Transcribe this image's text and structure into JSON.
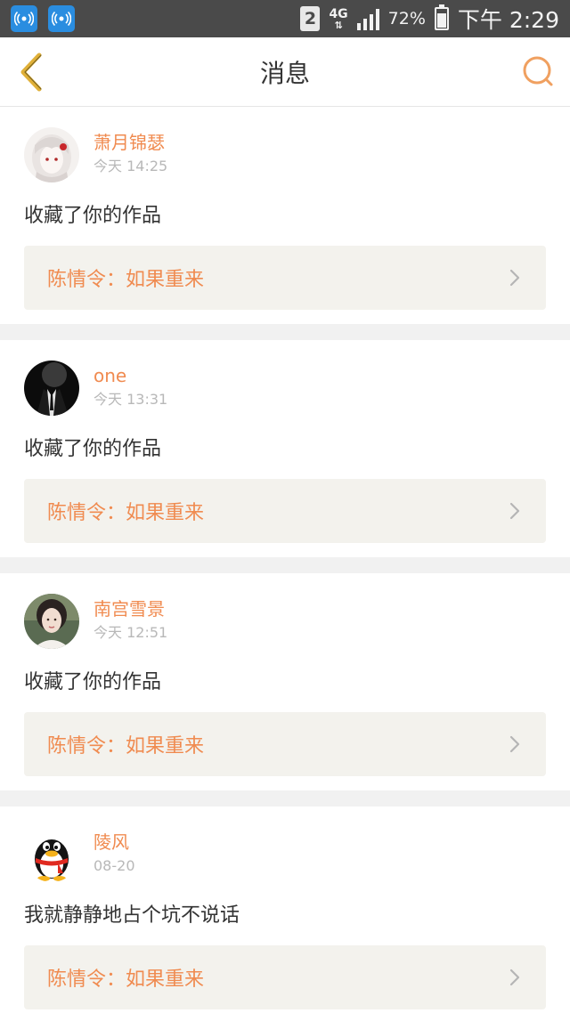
{
  "status_bar": {
    "sim": "2",
    "network": "4G",
    "battery": "72%",
    "battery_level": 0.72,
    "time": "下午 2:29",
    "app_icons": [
      "wifi-hotspot-icon",
      "wifi-hotspot-icon"
    ]
  },
  "nav": {
    "title": "消息",
    "back_icon": "back-chevron-icon",
    "search_icon": "search-icon"
  },
  "colors": {
    "accent": "#f08b50",
    "nav_icon": "#e0b038",
    "search_icon": "#f0a060"
  },
  "messages": [
    {
      "username": "萧月锦瑟",
      "time": "今天 14:25",
      "action": "收藏了你的作品",
      "work_title": "陈情令：如果重来",
      "avatar": "anime-girl-avatar"
    },
    {
      "username": "one",
      "time": "今天 13:31",
      "action": "收藏了你的作品",
      "work_title": "陈情令：如果重来",
      "avatar": "dark-suit-avatar"
    },
    {
      "username": "南宫雪景",
      "time": "今天 12:51",
      "action": "收藏了你的作品",
      "work_title": "陈情令：如果重来",
      "avatar": "woman-portrait-avatar"
    },
    {
      "username": "陵风",
      "time": "08-20",
      "action": "我就静静地占个坑不说话",
      "work_title": "陈情令：如果重来",
      "avatar": "qq-penguin-avatar"
    }
  ]
}
